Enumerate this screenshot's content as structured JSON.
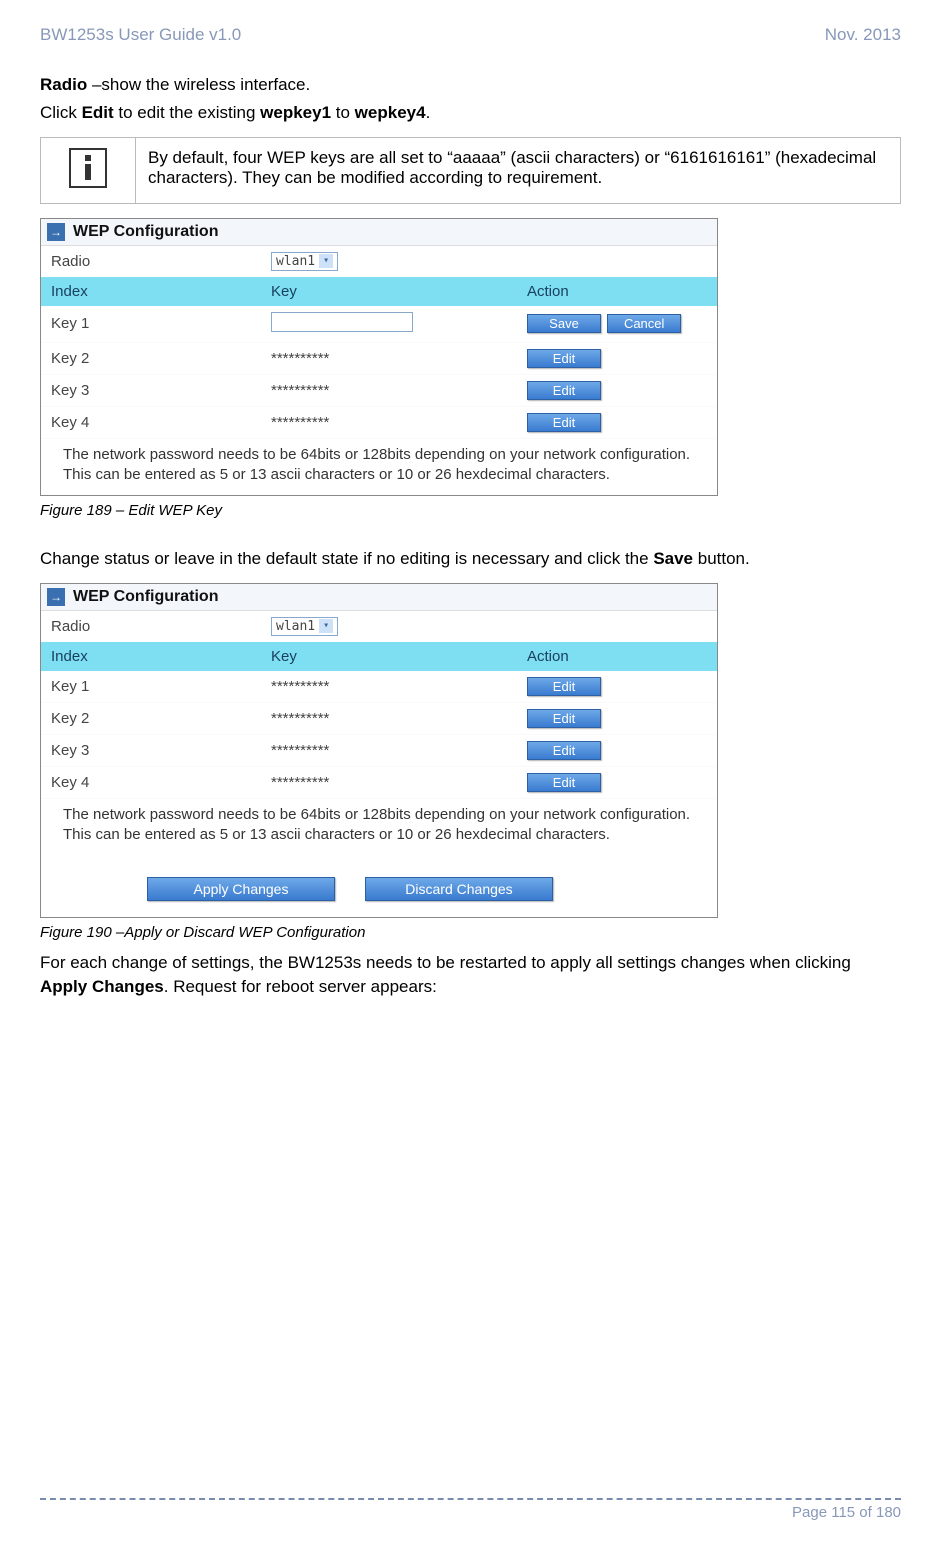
{
  "header": {
    "left": "BW1253s User Guide v1.0",
    "right": "Nov.  2013"
  },
  "intro": {
    "radio_label": "Radio",
    "radio_desc": " –show the wireless interface.",
    "edit_line_1": "Click ",
    "edit_bold_1": "Edit",
    "edit_line_2": " to edit the existing ",
    "edit_bold_2": "wepkey1",
    "edit_line_3": " to ",
    "edit_bold_3": "wepkey4",
    "edit_line_4": "."
  },
  "info_box": "By default, four WEP keys are all set to “aaaaa” (ascii characters) or “6161616161” (hexadecimal characters). They can be modified according to requirement.",
  "panel": {
    "title": "WEP Configuration",
    "radio_label": "Radio",
    "radio_value": "wlan1",
    "headers": {
      "index": "Index",
      "key": "Key",
      "action": "Action"
    },
    "rows_edit": [
      {
        "label": "Key 1",
        "key": "",
        "action": [
          "Save",
          "Cancel"
        ],
        "input": true
      },
      {
        "label": "Key 2",
        "key": "**********",
        "action": [
          "Edit"
        ]
      },
      {
        "label": "Key 3",
        "key": "**********",
        "action": [
          "Edit"
        ]
      },
      {
        "label": "Key 4",
        "key": "**********",
        "action": [
          "Edit"
        ]
      }
    ],
    "rows_view": [
      {
        "label": "Key 1",
        "key": "**********",
        "action": [
          "Edit"
        ]
      },
      {
        "label": "Key 2",
        "key": "**********",
        "action": [
          "Edit"
        ]
      },
      {
        "label": "Key 3",
        "key": "**********",
        "action": [
          "Edit"
        ]
      },
      {
        "label": "Key 4",
        "key": "**********",
        "action": [
          "Edit"
        ]
      }
    ],
    "note": "The network password needs to be 64bits or 128bits depending on your network configuration. This can be entered as 5 or 13 ascii characters or 10 or 26 hexdecimal characters."
  },
  "caption1": "Figure 189 – Edit WEP Key",
  "mid_text": {
    "pre": "Change status or leave in the default state if no editing is necessary and click the ",
    "bold": "Save",
    "post": " button."
  },
  "buttons": {
    "apply": "Apply Changes",
    "discard": "Discard Changes"
  },
  "caption2": "Figure 190 –Apply or Discard WEP Configuration",
  "tail": {
    "pre": "For each change of settings, the BW1253s needs to be restarted to apply all settings changes when clicking ",
    "bold": "Apply Changes",
    "post": ". Request for reboot server appears:"
  },
  "footer": "Page 115 of 180"
}
